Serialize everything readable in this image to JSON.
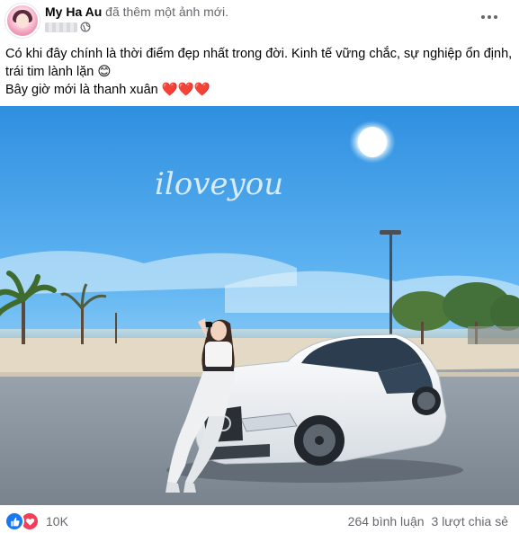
{
  "post": {
    "author": "My Ha Au",
    "action": "đã thêm một ảnh mới.",
    "privacy_icon": "globe-icon",
    "caption_lines": [
      "Có khi đây chính là thời điểm đẹp nhất trong đời. Kinh tế vững chắc, sự nghiệp ổn định, trái tim lành lặn 😊",
      "Bây giờ mới là thanh xuân ❤️❤️❤️"
    ],
    "photo_text": "iloveyou"
  },
  "footer": {
    "reaction_icons": [
      "like-icon",
      "love-icon"
    ],
    "reaction_count": "10K",
    "comments": "264 bình luận",
    "shares": "3 lượt chia sẻ"
  },
  "colors": {
    "like": "#1877f2",
    "love": "#f33e58",
    "secondary_text": "#65676b"
  }
}
